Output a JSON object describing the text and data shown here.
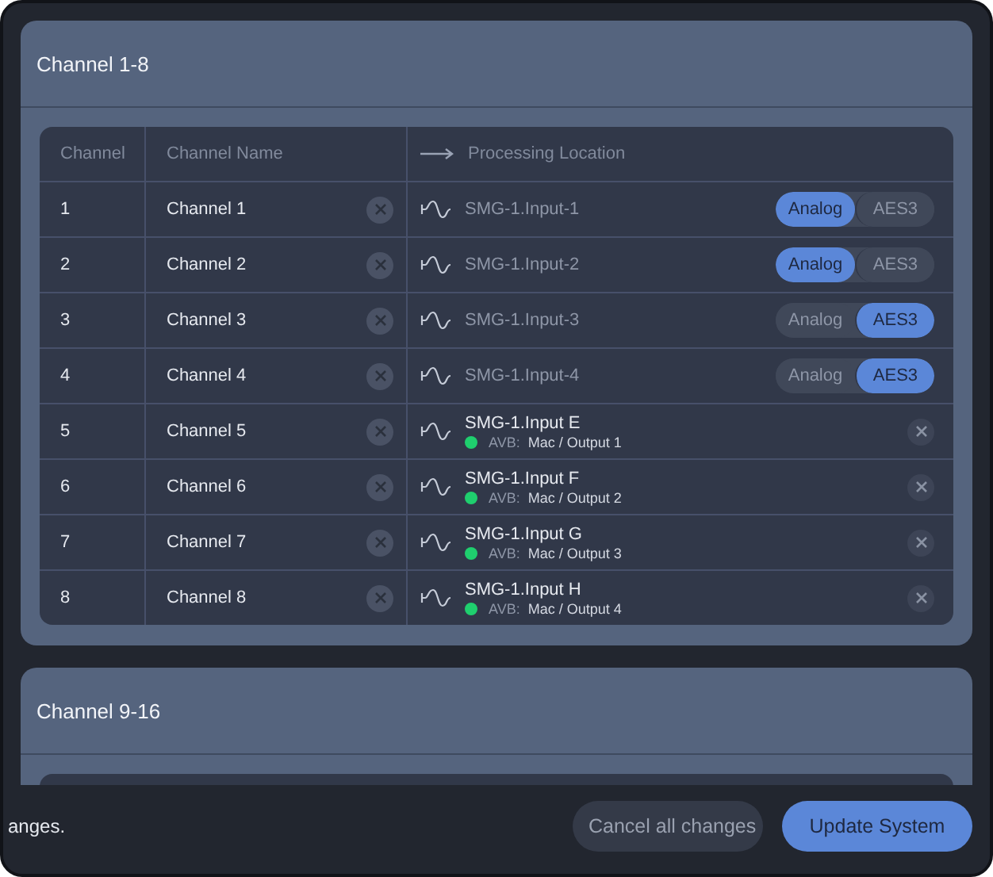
{
  "sections": [
    {
      "title": "Channel 1-8",
      "columns": [
        "Channel",
        "Channel Name",
        "Processing Location"
      ],
      "rows": [
        {
          "number": "1",
          "name": "Channel 1",
          "kind": "pair",
          "location": "SMG-1.Input-1",
          "options": [
            {
              "label": "Analog",
              "selected": true
            },
            {
              "label": "AES3",
              "selected": false
            }
          ]
        },
        {
          "number": "2",
          "name": "Channel 2",
          "kind": "pair",
          "location": "SMG-1.Input-2",
          "options": [
            {
              "label": "Analog",
              "selected": true
            },
            {
              "label": "AES3",
              "selected": false
            }
          ]
        },
        {
          "number": "3",
          "name": "Channel 3",
          "kind": "pair",
          "location": "SMG-1.Input-3",
          "options": [
            {
              "label": "Analog",
              "selected": false
            },
            {
              "label": "AES3",
              "selected": true
            }
          ]
        },
        {
          "number": "4",
          "name": "Channel 4",
          "kind": "pair",
          "location": "SMG-1.Input-4",
          "options": [
            {
              "label": "Analog",
              "selected": false
            },
            {
              "label": "AES3",
              "selected": true
            }
          ]
        },
        {
          "number": "5",
          "name": "Channel 5",
          "kind": "avb",
          "location": "SMG-1.Input E",
          "source_label": "AVB:",
          "source": "Mac / Output 1",
          "color": "#1fcf6e"
        },
        {
          "number": "6",
          "name": "Channel 6",
          "kind": "avb",
          "location": "SMG-1.Input F",
          "source_label": "AVB:",
          "source": "Mac / Output 2",
          "color": "#1fcf6e"
        },
        {
          "number": "7",
          "name": "Channel 7",
          "kind": "avb",
          "location": "SMG-1.Input G",
          "source_label": "AVB:",
          "source": "Mac / Output 3",
          "color": "#1fcf6e"
        },
        {
          "number": "8",
          "name": "Channel 8",
          "kind": "avb",
          "location": "SMG-1.Input H",
          "source_label": "AVB:",
          "source": "Mac / Output 4",
          "color": "#1fcf6e"
        }
      ]
    },
    {
      "title": "Channel 9-16"
    }
  ],
  "footer": {
    "message": "anges.",
    "buttons": [
      {
        "label": "Cancel all changes",
        "kind": "secondary"
      },
      {
        "label": "Update System",
        "kind": "primary"
      }
    ]
  }
}
